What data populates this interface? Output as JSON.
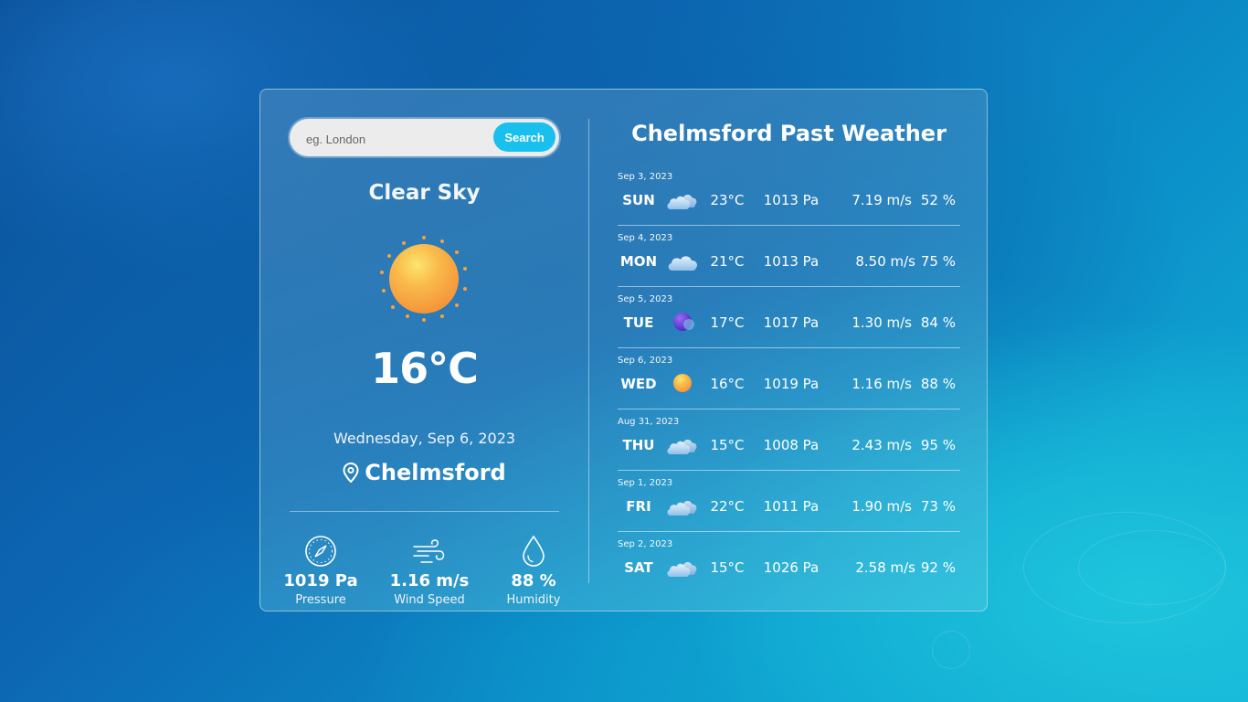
{
  "search": {
    "placeholder": "eg. London",
    "button_label": "Search"
  },
  "current": {
    "condition": "Clear Sky",
    "icon": "sun-icon",
    "temperature": "16°C",
    "date": "Wednesday, Sep 6, 2023",
    "city": "Chelmsford",
    "stats": [
      {
        "value": "1019 Pa",
        "label": "Pressure",
        "icon": "compass-icon"
      },
      {
        "value": "1.16 m/s",
        "label": "Wind Speed",
        "icon": "wind-icon"
      },
      {
        "value": "88 %",
        "label": "Humidity",
        "icon": "droplet-icon"
      }
    ]
  },
  "past": {
    "title": "Chelmsford Past Weather",
    "rows": [
      {
        "date": "Sep 3, 2023",
        "day": "SUN",
        "icon": "cloud-icon",
        "temp": "23°C",
        "pressure": "1013 Pa",
        "wind": "7.19 m/s",
        "humidity": "52 %"
      },
      {
        "date": "Sep 4, 2023",
        "day": "MON",
        "icon": "cloud-icon",
        "temp": "21°C",
        "pressure": "1013 Pa",
        "wind": "8.50 m/s",
        "humidity": "75 %"
      },
      {
        "date": "Sep 5, 2023",
        "day": "TUE",
        "icon": "moon-icon",
        "temp": "17°C",
        "pressure": "1017 Pa",
        "wind": "1.30 m/s",
        "humidity": "84 %"
      },
      {
        "date": "Sep 6, 2023",
        "day": "WED",
        "icon": "sun-icon",
        "temp": "16°C",
        "pressure": "1019 Pa",
        "wind": "1.16 m/s",
        "humidity": "88 %"
      },
      {
        "date": "Aug 31, 2023",
        "day": "THU",
        "icon": "cloud-icon",
        "temp": "15°C",
        "pressure": "1008 Pa",
        "wind": "2.43 m/s",
        "humidity": "95 %"
      },
      {
        "date": "Sep 1, 2023",
        "day": "FRI",
        "icon": "cloud-icon",
        "temp": "22°C",
        "pressure": "1011 Pa",
        "wind": "1.90 m/s",
        "humidity": "73 %"
      },
      {
        "date": "Sep 2, 2023",
        "day": "SAT",
        "icon": "cloud-icon",
        "temp": "15°C",
        "pressure": "1026 Pa",
        "wind": "2.58 m/s",
        "humidity": "92 %"
      }
    ]
  },
  "colors": {
    "accent": "#19c0ee",
    "sun": "#f7a23a"
  }
}
